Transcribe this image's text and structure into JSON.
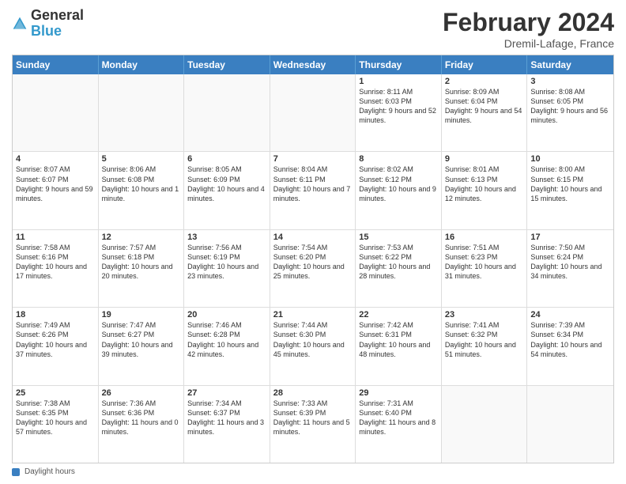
{
  "header": {
    "logo": {
      "general": "General",
      "blue": "Blue"
    },
    "month_year": "February 2024",
    "location": "Dremil-Lafage, France"
  },
  "weekdays": [
    "Sunday",
    "Monday",
    "Tuesday",
    "Wednesday",
    "Thursday",
    "Friday",
    "Saturday"
  ],
  "rows": [
    [
      {
        "day": "",
        "text": ""
      },
      {
        "day": "",
        "text": ""
      },
      {
        "day": "",
        "text": ""
      },
      {
        "day": "",
        "text": ""
      },
      {
        "day": "1",
        "text": "Sunrise: 8:11 AM\nSunset: 6:03 PM\nDaylight: 9 hours and 52 minutes."
      },
      {
        "day": "2",
        "text": "Sunrise: 8:09 AM\nSunset: 6:04 PM\nDaylight: 9 hours and 54 minutes."
      },
      {
        "day": "3",
        "text": "Sunrise: 8:08 AM\nSunset: 6:05 PM\nDaylight: 9 hours and 56 minutes."
      }
    ],
    [
      {
        "day": "4",
        "text": "Sunrise: 8:07 AM\nSunset: 6:07 PM\nDaylight: 9 hours and 59 minutes."
      },
      {
        "day": "5",
        "text": "Sunrise: 8:06 AM\nSunset: 6:08 PM\nDaylight: 10 hours and 1 minute."
      },
      {
        "day": "6",
        "text": "Sunrise: 8:05 AM\nSunset: 6:09 PM\nDaylight: 10 hours and 4 minutes."
      },
      {
        "day": "7",
        "text": "Sunrise: 8:04 AM\nSunset: 6:11 PM\nDaylight: 10 hours and 7 minutes."
      },
      {
        "day": "8",
        "text": "Sunrise: 8:02 AM\nSunset: 6:12 PM\nDaylight: 10 hours and 9 minutes."
      },
      {
        "day": "9",
        "text": "Sunrise: 8:01 AM\nSunset: 6:13 PM\nDaylight: 10 hours and 12 minutes."
      },
      {
        "day": "10",
        "text": "Sunrise: 8:00 AM\nSunset: 6:15 PM\nDaylight: 10 hours and 15 minutes."
      }
    ],
    [
      {
        "day": "11",
        "text": "Sunrise: 7:58 AM\nSunset: 6:16 PM\nDaylight: 10 hours and 17 minutes."
      },
      {
        "day": "12",
        "text": "Sunrise: 7:57 AM\nSunset: 6:18 PM\nDaylight: 10 hours and 20 minutes."
      },
      {
        "day": "13",
        "text": "Sunrise: 7:56 AM\nSunset: 6:19 PM\nDaylight: 10 hours and 23 minutes."
      },
      {
        "day": "14",
        "text": "Sunrise: 7:54 AM\nSunset: 6:20 PM\nDaylight: 10 hours and 25 minutes."
      },
      {
        "day": "15",
        "text": "Sunrise: 7:53 AM\nSunset: 6:22 PM\nDaylight: 10 hours and 28 minutes."
      },
      {
        "day": "16",
        "text": "Sunrise: 7:51 AM\nSunset: 6:23 PM\nDaylight: 10 hours and 31 minutes."
      },
      {
        "day": "17",
        "text": "Sunrise: 7:50 AM\nSunset: 6:24 PM\nDaylight: 10 hours and 34 minutes."
      }
    ],
    [
      {
        "day": "18",
        "text": "Sunrise: 7:49 AM\nSunset: 6:26 PM\nDaylight: 10 hours and 37 minutes."
      },
      {
        "day": "19",
        "text": "Sunrise: 7:47 AM\nSunset: 6:27 PM\nDaylight: 10 hours and 39 minutes."
      },
      {
        "day": "20",
        "text": "Sunrise: 7:46 AM\nSunset: 6:28 PM\nDaylight: 10 hours and 42 minutes."
      },
      {
        "day": "21",
        "text": "Sunrise: 7:44 AM\nSunset: 6:30 PM\nDaylight: 10 hours and 45 minutes."
      },
      {
        "day": "22",
        "text": "Sunrise: 7:42 AM\nSunset: 6:31 PM\nDaylight: 10 hours and 48 minutes."
      },
      {
        "day": "23",
        "text": "Sunrise: 7:41 AM\nSunset: 6:32 PM\nDaylight: 10 hours and 51 minutes."
      },
      {
        "day": "24",
        "text": "Sunrise: 7:39 AM\nSunset: 6:34 PM\nDaylight: 10 hours and 54 minutes."
      }
    ],
    [
      {
        "day": "25",
        "text": "Sunrise: 7:38 AM\nSunset: 6:35 PM\nDaylight: 10 hours and 57 minutes."
      },
      {
        "day": "26",
        "text": "Sunrise: 7:36 AM\nSunset: 6:36 PM\nDaylight: 11 hours and 0 minutes."
      },
      {
        "day": "27",
        "text": "Sunrise: 7:34 AM\nSunset: 6:37 PM\nDaylight: 11 hours and 3 minutes."
      },
      {
        "day": "28",
        "text": "Sunrise: 7:33 AM\nSunset: 6:39 PM\nDaylight: 11 hours and 5 minutes."
      },
      {
        "day": "29",
        "text": "Sunrise: 7:31 AM\nSunset: 6:40 PM\nDaylight: 11 hours and 8 minutes."
      },
      {
        "day": "",
        "text": ""
      },
      {
        "day": "",
        "text": ""
      }
    ]
  ],
  "footer": {
    "daylight_label": "Daylight hours"
  }
}
